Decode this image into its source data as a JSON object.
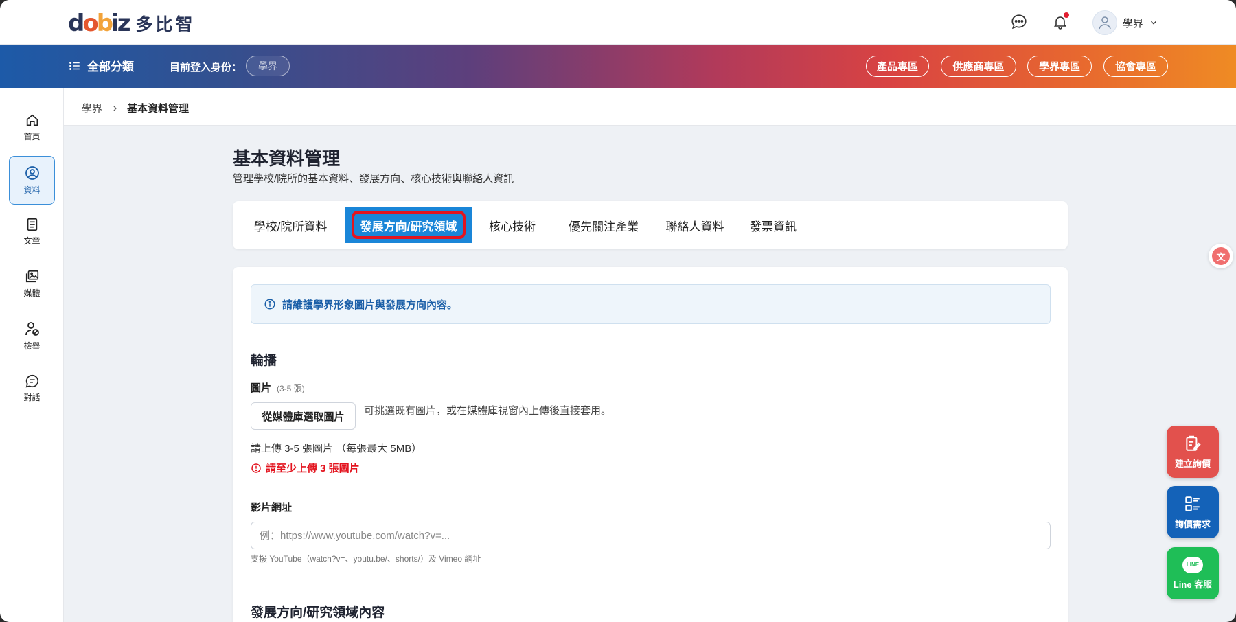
{
  "brand": {
    "logo_text": "多比智"
  },
  "header": {
    "user_name": "學界"
  },
  "nav": {
    "menu_label": "全部分類",
    "login_as_label": "目前登入身份：",
    "role": "學界",
    "zones": [
      "產品專區",
      "供應商專區",
      "學界專區",
      "協會專區"
    ]
  },
  "sidebar": {
    "items": [
      {
        "label": "首頁",
        "icon": "home-icon"
      },
      {
        "label": "資料",
        "icon": "user-circle-icon"
      },
      {
        "label": "文章",
        "icon": "document-icon"
      },
      {
        "label": "媒體",
        "icon": "media-icon"
      },
      {
        "label": "檢舉",
        "icon": "report-user-icon"
      },
      {
        "label": "對話",
        "icon": "chat-icon"
      }
    ]
  },
  "breadcrumb": {
    "home": "學界",
    "current": "基本資料管理"
  },
  "page": {
    "title": "基本資料管理",
    "subtitle": "管理學校/院所的基本資料、發展方向、核心技術與聯絡人資訊"
  },
  "tabs": [
    "學校/院所資料",
    "發展方向/研究領域",
    "核心技術",
    "優先關注產業",
    "聯絡人資料",
    "發票資訊"
  ],
  "form": {
    "info": "請維護學界形象圖片與發展方向內容。",
    "carousel_title": "輪播",
    "image_label": "圖片",
    "image_hint": "(3-5 張)",
    "pick_button": "從媒體庫選取圖片",
    "pick_desc": "可挑選既有圖片，或在媒體庫視窗內上傳後直接套用。",
    "upload_note": "請上傳 3-5 張圖片 （每張最大 5MB）",
    "error": "請至少上傳 3 張圖片",
    "video_label": "影片網址",
    "video_placeholder": "例：https://www.youtube.com/watch?v=...",
    "video_help": "支援 YouTube（watch?v=、youtu.be/、shorts/）及 Vimeo 網址",
    "direction_title": "發展方向/研究領域內容"
  },
  "floating": {
    "quote": "建立詢價",
    "inquiry": "詢價需求",
    "line": "Line 客服",
    "line_badge": "LINE"
  },
  "colors": {
    "accent": "#1a86d8",
    "highlight": "#e3141f",
    "error": "#e3141f",
    "fab_red": "#e2514d",
    "fab_blue": "#1462b8",
    "fab_green": "#1fbe57"
  }
}
